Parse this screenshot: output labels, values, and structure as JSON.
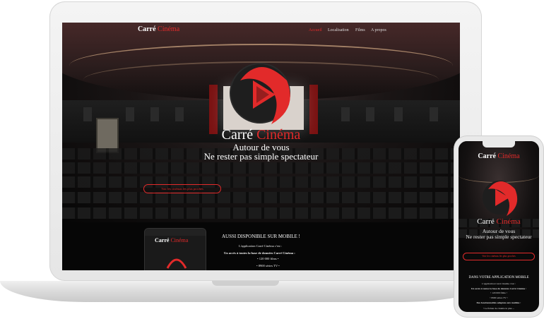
{
  "brand": {
    "part1": "Carré",
    "part2": "Cinéma"
  },
  "nav": {
    "items": [
      "Accueil",
      "Localisation",
      "Films",
      "A propos"
    ]
  },
  "hero": {
    "title_part1": "Carré",
    "title_part2": "Cinéma",
    "subtitle1": "Autour de vous",
    "subtitle2": "Ne rester pas simple spectateur",
    "button": "Voir les cinémas les plus proches"
  },
  "mobile_section": {
    "heading": "AUSSI DISPONIBLE SUR MOBILE !",
    "intro": "L'application Carré Cinéma c'est :",
    "access": "Un accès à toutes la base de données Carré Cinéma :",
    "films": "• 120 000 films •",
    "series": "• 8900 séries TV •"
  },
  "phone": {
    "heading": "DANS VOTRE APPLICATION MOBILE",
    "intro": "L'application Carré Cinéma c'est :",
    "access": "Un accès à toutes la base de données Carré Cinéma :",
    "films": "• 120 000 films •",
    "series": "• 8900 séries TV •",
    "features": "Des fonctionnalités adaptées aux mobiles :",
    "more": "• Le fichier de cinéma le plus ..."
  },
  "colors": {
    "accent": "#e22a2a",
    "background": "#0a0a0a",
    "device": "#e9e9e9"
  }
}
